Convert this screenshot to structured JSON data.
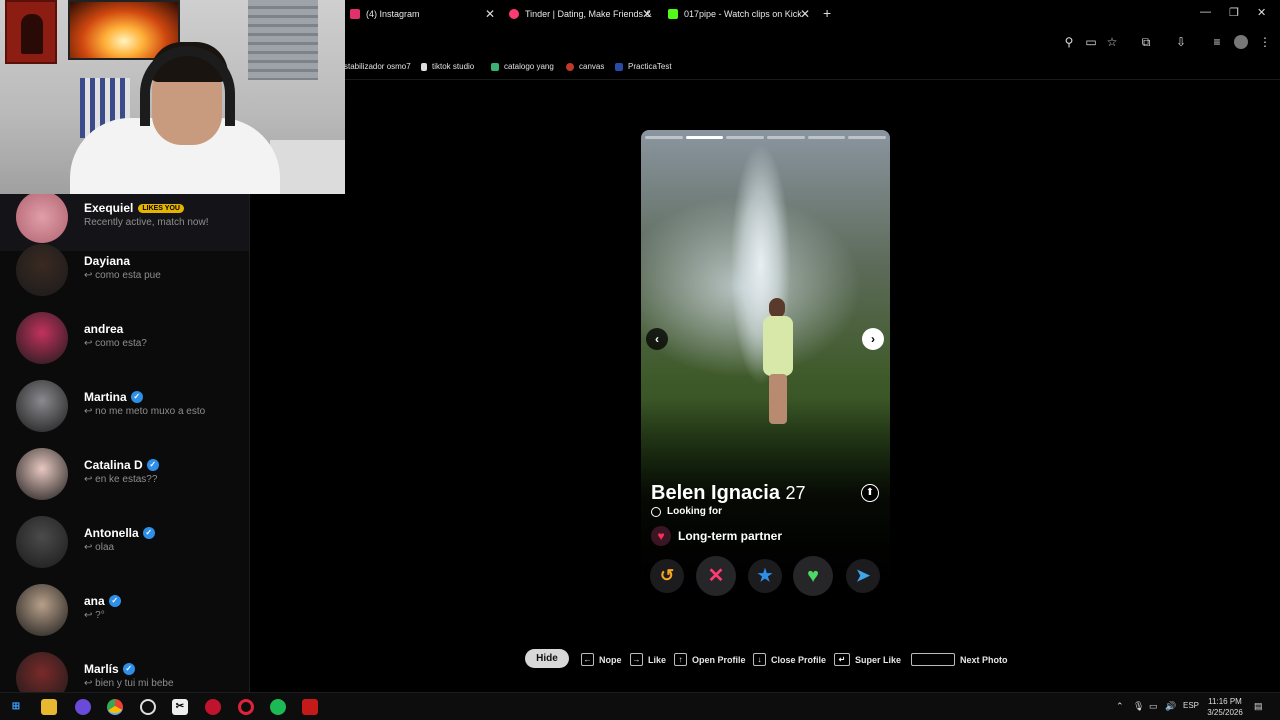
{
  "browser": {
    "tabs": [
      {
        "title": "(4) Instagram",
        "icon": "instagram-icon",
        "color": "#e1306c"
      },
      {
        "title": "Tinder | Dating, Make Friends &",
        "icon": "tinder-icon",
        "color": "#fe3c72"
      },
      {
        "title": "017pipe - Watch clips on Kick",
        "icon": "kick-icon",
        "color": "#53fc18"
      }
    ],
    "new_tab": "+",
    "window_controls": {
      "minimize": "—",
      "restore": "❐",
      "close": "✕"
    },
    "bookmarks": [
      {
        "label": "stabilizador osmo7"
      },
      {
        "label": "tiktok studio",
        "icon": "tiktok-icon"
      },
      {
        "label": "catalogo yang",
        "icon": "leaf-icon"
      },
      {
        "label": "canvas",
        "icon": "canvas-icon"
      },
      {
        "label": "PracticaTest",
        "icon": "practicatest-icon"
      }
    ]
  },
  "matches": [
    {
      "name": "Exequiel",
      "badge": "LIKES YOU",
      "message": "Recently active, match now!",
      "online": true,
      "avatar_color": "#d88a94"
    },
    {
      "name": "Dayiana",
      "message": "↩ como esta pue",
      "verified": false,
      "avatar_color": "#3a2a22"
    },
    {
      "name": "andrea",
      "message": "↩ como esta?",
      "verified": false,
      "avatar_color": "#c2325e"
    },
    {
      "name": "Martina",
      "message": "↩ no me meto muxo a esto",
      "verified": true,
      "avatar_color": "#8a8a8f"
    },
    {
      "name": "Catalina D",
      "message": "↩ en ke estas??",
      "verified": true,
      "avatar_color": "#e8c8c0"
    },
    {
      "name": "Antonella",
      "message": "↩ olaa",
      "verified": true,
      "avatar_color": "#4b4b4b"
    },
    {
      "name": "ana",
      "message": "↩ ?°",
      "verified": true,
      "avatar_color": "#b8a08a"
    },
    {
      "name": "Marlís",
      "message": "↩ bien y tui mi bebe",
      "verified": true,
      "avatar_color": "#7a2a2a"
    }
  ],
  "profile": {
    "name": "Belen Ignacia",
    "age": "27",
    "looking_for_label": "Looking for",
    "goal": "Long-term partner",
    "photo_count": 6,
    "active_photo": 1
  },
  "actions": {
    "rewind": "↺",
    "nope": "✕",
    "super_like": "★",
    "like": "♥",
    "boost": "➤"
  },
  "hints": {
    "hide": "Hide",
    "nope": "Nope",
    "like": "Like",
    "open_profile": "Open Profile",
    "close_profile": "Close Profile",
    "super_like": "Super Like",
    "next_photo": "Next Photo"
  },
  "taskbar": {
    "lang": "ESP",
    "time": "11:16 PM",
    "date": "3/25/2026"
  }
}
